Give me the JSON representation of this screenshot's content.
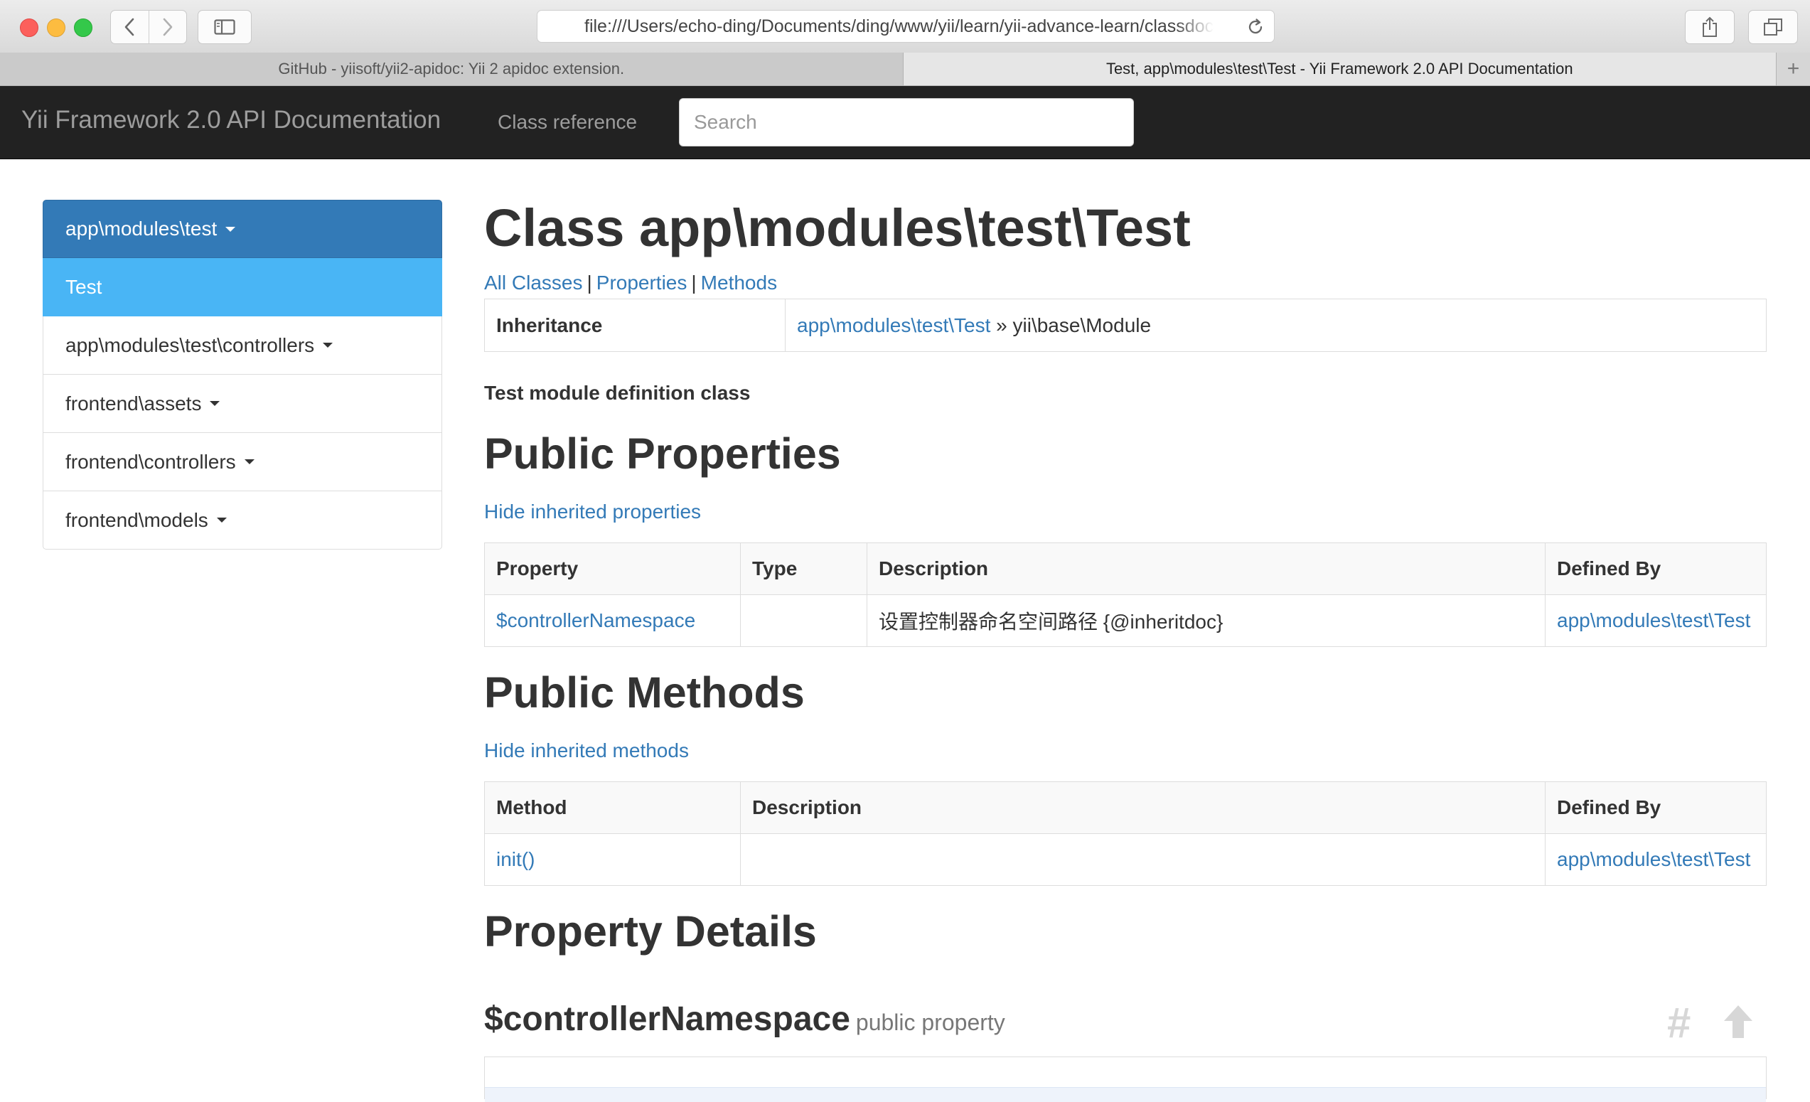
{
  "browser": {
    "url": "file:///Users/echo-ding/Documents/ding/www/yii/learn/yii-advance-learn/classdoc",
    "tabs": [
      {
        "title": "GitHub - yiisoft/yii2-apidoc: Yii 2 apidoc extension.",
        "active": false
      },
      {
        "title": "Test, app\\modules\\test\\Test - Yii Framework 2.0 API Documentation",
        "active": true
      }
    ],
    "new_tab_label": "+"
  },
  "navbar": {
    "brand": "Yii Framework 2.0 API Documentation",
    "class_reference": "Class reference",
    "search_placeholder": "Search"
  },
  "sidebar": {
    "items": [
      {
        "label": "app\\modules\\test",
        "state": "header",
        "has_caret": true
      },
      {
        "label": "Test",
        "state": "active",
        "has_caret": false
      },
      {
        "label": "app\\modules\\test\\controllers",
        "state": "normal",
        "has_caret": true
      },
      {
        "label": "frontend\\assets",
        "state": "normal",
        "has_caret": true
      },
      {
        "label": "frontend\\controllers",
        "state": "normal",
        "has_caret": true
      },
      {
        "label": "frontend\\models",
        "state": "normal",
        "has_caret": true
      }
    ]
  },
  "main": {
    "title": "Class app\\modules\\test\\Test",
    "toc": {
      "all_classes": "All Classes",
      "properties": "Properties",
      "methods": "Methods",
      "separator": "|"
    },
    "inheritance": {
      "label": "Inheritance",
      "link": "app\\modules\\test\\Test",
      "arrow": "»",
      "parent": "yii\\base\\Module"
    },
    "summary": "Test module definition class",
    "public_properties": {
      "heading": "Public Properties",
      "toggle": "Hide inherited properties",
      "columns": [
        "Property",
        "Type",
        "Description",
        "Defined By"
      ],
      "rows": [
        {
          "property": "$controllerNamespace",
          "type": "",
          "description": "设置控制器命名空间路径 {@inheritdoc}",
          "defined_by": "app\\modules\\test\\Test"
        }
      ]
    },
    "public_methods": {
      "heading": "Public Methods",
      "toggle": "Hide inherited methods",
      "columns": [
        "Method",
        "Description",
        "Defined By"
      ],
      "rows": [
        {
          "method": "init()",
          "description": "",
          "defined_by": "app\\modules\\test\\Test"
        }
      ]
    },
    "property_details": {
      "heading": "Property Details",
      "item_name": "$controllerNamespace",
      "item_kind": "public property",
      "hash_icon": "#"
    }
  },
  "colors": {
    "navbar_bg": "#222222",
    "link": "#337ab7",
    "sidebar_header": "#337ab7",
    "sidebar_active": "#49b5f5"
  }
}
